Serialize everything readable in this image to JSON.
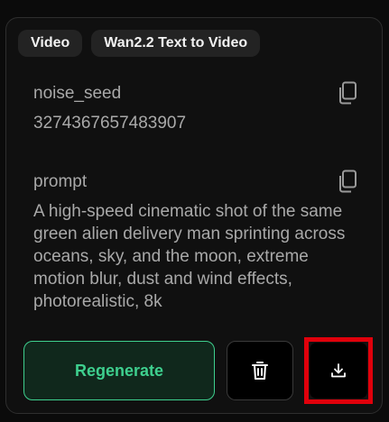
{
  "tags": [
    "Video",
    "Wan2.2 Text to Video"
  ],
  "fields": {
    "noise_seed": {
      "label": "noise_seed",
      "value": "3274367657483907"
    },
    "prompt": {
      "label": "prompt",
      "value": "A high-speed cinematic shot of the same green alien delivery man sprinting across oceans, sky, and the moon, extreme motion blur, dust and wind effects, photorealistic, 8k"
    }
  },
  "actions": {
    "regenerate_label": "Regenerate",
    "delete_icon": "trash-icon",
    "download_icon": "download-icon"
  },
  "colors": {
    "accent": "#3ecf8e",
    "highlight": "#e0000b"
  }
}
